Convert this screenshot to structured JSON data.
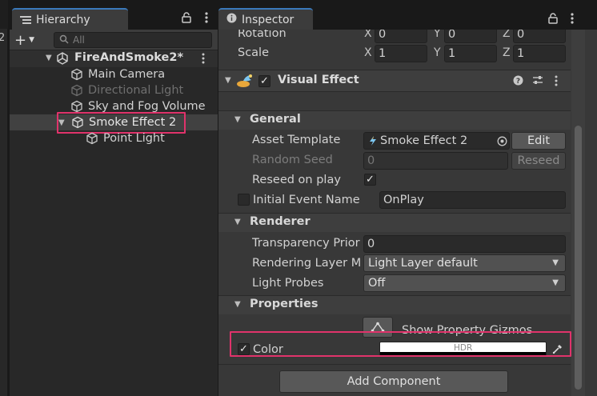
{
  "left_strip": {
    "digit": "2"
  },
  "hierarchy": {
    "tab_label": "Hierarchy",
    "search_placeholder": "All",
    "scene_name": "FireAndSmoke2*",
    "items": [
      {
        "label": "Main Camera",
        "disabled": false
      },
      {
        "label": "Directional Light",
        "disabled": true
      },
      {
        "label": "Sky and Fog Volume",
        "disabled": false
      },
      {
        "label": "Smoke Effect 2",
        "disabled": false,
        "selected": true
      },
      {
        "label": "Point Light",
        "disabled": false
      }
    ]
  },
  "inspector": {
    "tab_label": "Inspector",
    "rotation": {
      "label": "Rotation",
      "x_label": "X",
      "x": "0",
      "y_label": "Y",
      "y": "0",
      "z_label": "Z",
      "z": "0"
    },
    "scale": {
      "label": "Scale",
      "x_label": "X",
      "x": "1",
      "y_label": "Y",
      "y": "1",
      "z_label": "Z",
      "z": "1"
    },
    "component": {
      "title": "Visual Effect",
      "enabled": true,
      "general": {
        "header": "General",
        "asset_template_label": "Asset Template",
        "asset_template_value": "Smoke Effect 2",
        "edit_label": "Edit",
        "random_seed_label": "Random Seed",
        "random_seed_value": "0",
        "reseed_label": "Reseed",
        "reseed_on_play_label": "Reseed on play",
        "reseed_on_play": true,
        "initial_event_label": "Initial Event Name",
        "initial_event_value": "OnPlay"
      },
      "renderer": {
        "header": "Renderer",
        "transparency_label": "Transparency Prior",
        "transparency_value": "0",
        "layer_mask_label": "Rendering Layer M",
        "layer_mask_value": "Light Layer default",
        "light_probes_label": "Light Probes",
        "light_probes_value": "Off"
      },
      "properties": {
        "header": "Properties",
        "gizmos_label": "Show Property Gizmos",
        "color_label": "Color",
        "color_enabled": true,
        "color_value": "#FFFFFF",
        "hdr_label": "HDR"
      }
    },
    "add_component_label": "Add Component"
  },
  "colors": {
    "accent_tab": "#3a79bb",
    "highlight": "#e0336b"
  }
}
